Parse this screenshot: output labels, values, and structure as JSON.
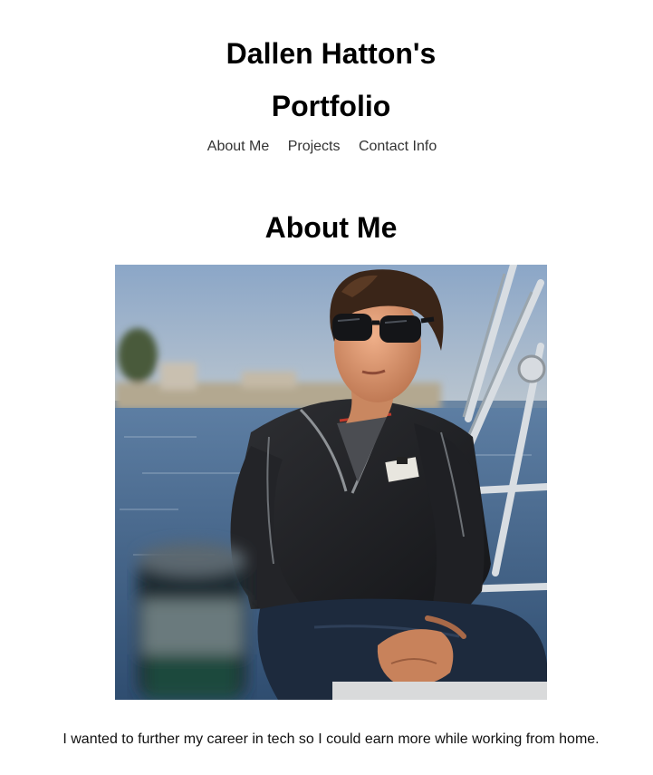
{
  "header": {
    "title_line1": "Dallen Hatton's",
    "title_line2": "Portfolio"
  },
  "nav": {
    "items": [
      {
        "label": "About Me"
      },
      {
        "label": "Projects"
      },
      {
        "label": "Contact Info"
      }
    ]
  },
  "about": {
    "heading": "About Me",
    "bio": "I wanted to further my career in tech so I could earn more while working from home."
  }
}
